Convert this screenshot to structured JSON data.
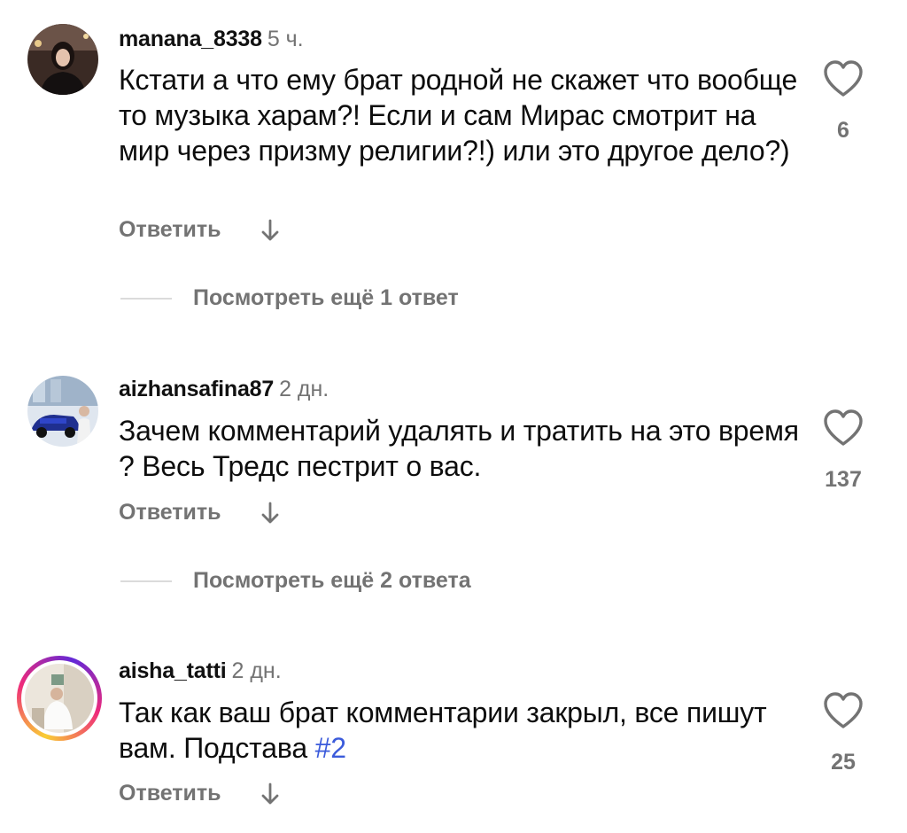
{
  "comments": [
    {
      "username": "manana_8338",
      "time": "5 ч.",
      "text": "Кстати а что ему брат родной не скажет что вообще то музыка харам?! Если и сам Мирас смотрит на мир через призму религии?!) или это другое дело?)",
      "reply_label": "Ответить",
      "likes": "6",
      "view_more": "Посмотреть ещё 1 ответ"
    },
    {
      "username": "aizhansafina87",
      "time": "2 дн.",
      "text": "Зачем комментарий удалять и тратить на это время ? Весь Тредс пестрит о вас.",
      "reply_label": "Ответить",
      "likes": "137",
      "view_more": "Посмотреть ещё 2 ответа"
    },
    {
      "username": "aisha_tatti",
      "time": "2 дн.",
      "text": "Так как ваш брат комментарии закрыл, все пишут вам. Подстава ",
      "hashtag": "#2",
      "reply_label": "Ответить",
      "likes": "25"
    }
  ],
  "icons": {
    "like": "heart-outline-icon",
    "expand": "arrow-down-icon",
    "hashtag_color": "#3b5bdb"
  }
}
